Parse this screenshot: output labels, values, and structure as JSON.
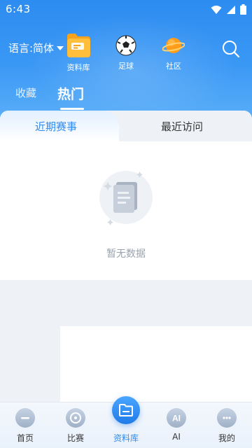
{
  "status_bar": {
    "time": "6:43"
  },
  "header": {
    "language_label": "语言:简体",
    "nav": [
      {
        "label": "资料库",
        "icon": "folder-icon"
      },
      {
        "label": "足球",
        "icon": "soccer-ball-icon"
      },
      {
        "label": "社区",
        "icon": "planet-icon"
      }
    ],
    "tabs": {
      "favorites": "收藏",
      "hot": "热门"
    }
  },
  "segment": {
    "recent_matches": "近期赛事",
    "recent_visits": "最近访问"
  },
  "empty_state": {
    "text": "暂无数据",
    "icon": "document-icon"
  },
  "bottom_nav": [
    {
      "label": "首页",
      "icon": "home-icon"
    },
    {
      "label": "比赛",
      "icon": "match-icon"
    },
    {
      "label": "资料库",
      "icon": "folder-icon",
      "active": true
    },
    {
      "label": "AI",
      "icon": "ai-icon"
    },
    {
      "label": "我的",
      "icon": "profile-icon"
    }
  ],
  "colors": {
    "primary": "#2d8cf0",
    "muted_text": "#9aa3ad"
  }
}
